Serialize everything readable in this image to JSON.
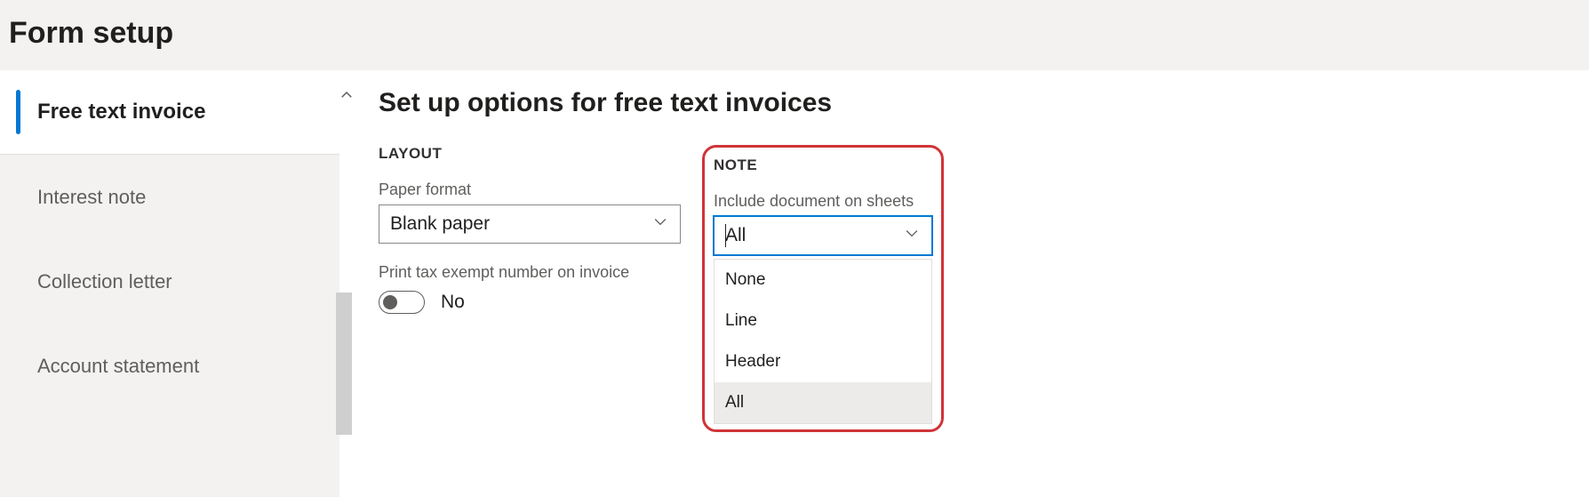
{
  "page": {
    "title": "Form setup"
  },
  "sidebar": {
    "items": [
      {
        "label": "Free text invoice"
      },
      {
        "label": "Interest note"
      },
      {
        "label": "Collection letter"
      },
      {
        "label": "Account statement"
      }
    ]
  },
  "main": {
    "heading": "Set up options for free text invoices",
    "layout": {
      "section_label": "LAYOUT",
      "paper_format_label": "Paper format",
      "paper_format_value": "Blank paper",
      "print_tax_label": "Print tax exempt number on invoice",
      "print_tax_value": "No"
    },
    "note": {
      "section_label": "NOTE",
      "include_label": "Include document on sheets",
      "include_value": "All",
      "options": [
        {
          "label": "None"
        },
        {
          "label": "Line"
        },
        {
          "label": "Header"
        },
        {
          "label": "All"
        }
      ]
    }
  }
}
